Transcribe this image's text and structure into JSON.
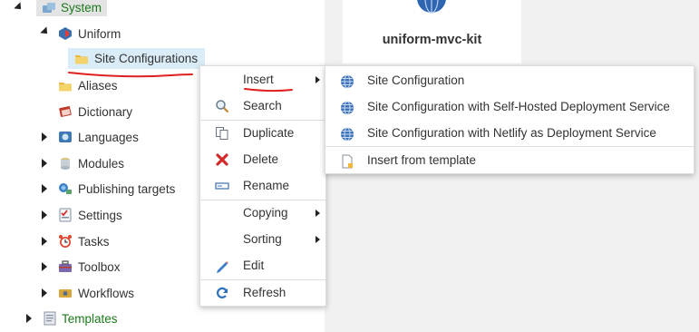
{
  "tree": {
    "items": [
      {
        "label": "System"
      },
      {
        "label": "Uniform"
      },
      {
        "label": "Site Configurations"
      },
      {
        "label": "Aliases"
      },
      {
        "label": "Dictionary"
      },
      {
        "label": "Languages"
      },
      {
        "label": "Modules"
      },
      {
        "label": "Publishing targets"
      },
      {
        "label": "Settings"
      },
      {
        "label": "Tasks"
      },
      {
        "label": "Toolbox"
      },
      {
        "label": "Workflows"
      },
      {
        "label": "Templates"
      }
    ]
  },
  "card": {
    "title": "uniform-mvc-kit"
  },
  "context_menu": {
    "items": [
      {
        "label": "Insert",
        "icon": "none"
      },
      {
        "label": "Search",
        "icon": "magnifier-icon"
      },
      {
        "label": "Duplicate",
        "icon": "copy-icon"
      },
      {
        "label": "Delete",
        "icon": "red-x-icon"
      },
      {
        "label": "Rename",
        "icon": "rename-icon"
      },
      {
        "label": "Copying",
        "icon": "none"
      },
      {
        "label": "Sorting",
        "icon": "none"
      },
      {
        "label": "Edit",
        "icon": "pencil-icon"
      },
      {
        "label": "Refresh",
        "icon": "refresh-icon"
      }
    ]
  },
  "submenu": {
    "items": [
      {
        "label": "Site Configuration",
        "icon": "globe-icon"
      },
      {
        "label": "Site Configuration with Self-Hosted Deployment Service",
        "icon": "globe-icon"
      },
      {
        "label": "Site Configuration with Netlify as Deployment Service",
        "icon": "globe-icon"
      },
      {
        "label": "Insert from template",
        "icon": "template-icon"
      }
    ]
  },
  "colors": {
    "selection": "#d9ecf7",
    "green_text": "#1b7a1b",
    "annotation_red": "#e02020",
    "content_bg": "#f1f1f1"
  }
}
